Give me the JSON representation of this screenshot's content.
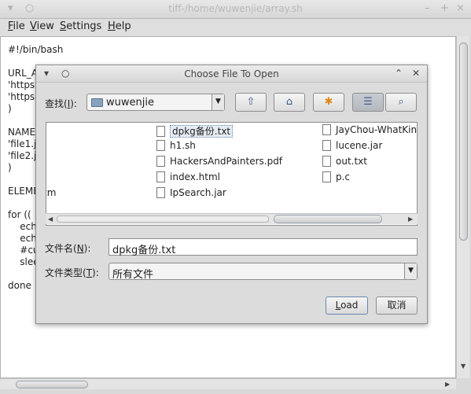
{
  "window": {
    "title": "tiff-/home/wuwenjie/array.sh",
    "controls": [
      "–",
      "+",
      "×"
    ],
    "menu": [
      {
        "label": "File",
        "mnemonic": "F"
      },
      {
        "label": "View",
        "mnemonic": "V"
      },
      {
        "label": "Settings",
        "mnemonic": "S"
      },
      {
        "label": "Help",
        "mnemonic": "H"
      }
    ]
  },
  "editor": {
    "lines": [
      "#!/bin/bash",
      "",
      "URL_A",
      "'https",
      "'https",
      ")",
      "",
      "NAME_",
      "'file1.j",
      "'file2.j",
      ")",
      "",
      "ELEME",
      "",
      "for ((",
      "    ech",
      "    ech",
      "    #cu",
      "    slee",
      "",
      "done"
    ]
  },
  "dialog": {
    "title": "Choose File To Open",
    "look_in_label": "查找(I):",
    "look_in_mnemonic": "I",
    "current_folder": "wuwenjie",
    "toolbar_icons": [
      "up-folder-icon",
      "home-icon",
      "new-folder-icon",
      "list-view-icon",
      "details-view-icon"
    ],
    "files_col0": [
      "",
      "",
      "",
      "tm",
      ""
    ],
    "files_col1": [
      "dpkg备份.txt",
      "h1.sh",
      "HackersAndPainters.pdf",
      "index.html",
      "IpSearch.jar"
    ],
    "files_col2": [
      "JayChou-WhatKind",
      "lucene.jar",
      "out.txt",
      "p.c"
    ],
    "selected_file": "dpkg备份.txt",
    "file_name_label": "文件名(N):",
    "file_name_mnemonic": "N",
    "file_name_value": "dpkg备份.txt",
    "file_type_label": "文件类型(T):",
    "file_type_mnemonic": "T",
    "file_type_value": "所有文件",
    "load_button": "Load",
    "cancel_button": "取消"
  }
}
